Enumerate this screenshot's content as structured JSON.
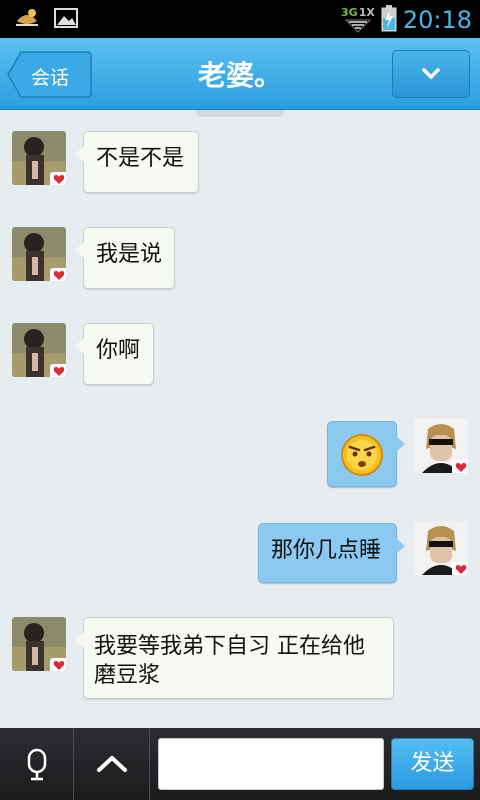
{
  "status_bar": {
    "time": "20:18",
    "network": "3G",
    "network_alt": "1X",
    "icons": [
      "app-notification-icon",
      "image-notification-icon",
      "signal-icon",
      "battery-charging-icon"
    ]
  },
  "header": {
    "back_label": "会话",
    "title": "老婆。",
    "menu_icon": "chevron-down-icon"
  },
  "messages": [
    {
      "side": "left",
      "text": "不是不是"
    },
    {
      "side": "left",
      "text": "我是说"
    },
    {
      "side": "left",
      "text": "你啊"
    },
    {
      "side": "right",
      "text": "",
      "emoji": "angry-face-emoji"
    },
    {
      "side": "right",
      "text": "那你几点睡"
    },
    {
      "side": "left",
      "text": "我要等我弟下自习 正在给他磨豆浆"
    }
  ],
  "composer": {
    "voice_icon": "microphone-icon",
    "expand_icon": "chevron-up-icon",
    "input_value": "",
    "input_placeholder": "",
    "send_label": "发送"
  },
  "colors": {
    "header_blue": "#2b9ddf",
    "status_time": "#49b6e8",
    "outgoing_bubble": "#8cc9f0",
    "incoming_bubble": "#f6faf3",
    "background": "#e6ecef",
    "heart_red": "#e0283c"
  }
}
